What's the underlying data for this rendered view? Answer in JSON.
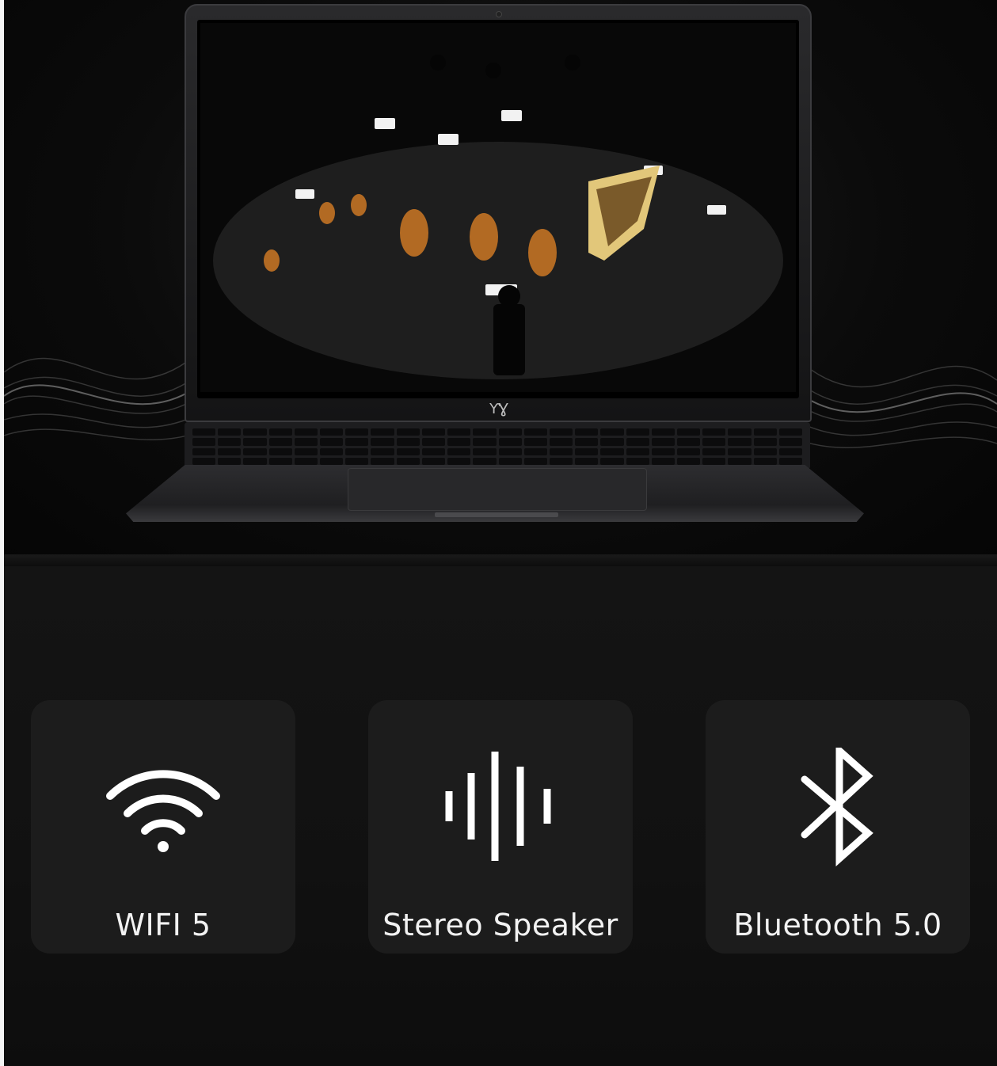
{
  "features": [
    {
      "icon": "wifi-icon",
      "label": "WIFI 5"
    },
    {
      "icon": "sound-wave-icon",
      "label": "Stereo Speaker"
    },
    {
      "icon": "bluetooth-icon",
      "label": "Bluetooth 5.0"
    }
  ],
  "colors": {
    "background": "#000000",
    "card": "#1c1c1c",
    "text": "#f2f2f2"
  }
}
